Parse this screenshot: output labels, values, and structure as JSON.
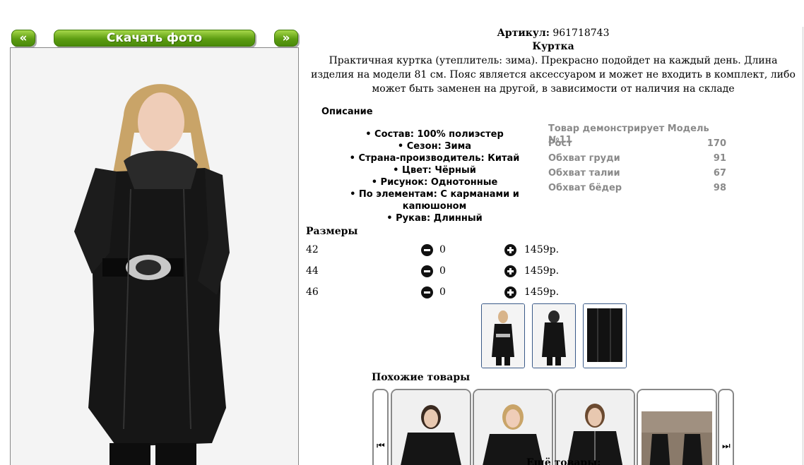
{
  "gallery": {
    "prev_label": "«",
    "next_label": "»",
    "download_label": "Скачать фото"
  },
  "product": {
    "article_label": "Артикул:",
    "article_value": "961718743",
    "title": "Куртка",
    "description": "Практичная куртка (утеплитель: зима). Прекрасно подойдет на каждый день. Длина изделия на модели 81 см. Пояс является аксессуаром и может не входить в комплект, либо может быть заменен на другой, в зависимости от наличия на складе"
  },
  "specs": {
    "title": "Описание",
    "items": [
      "• Состав: 100% полиэстер",
      "• Сезон: Зима",
      "• Страна-производитель: Китай",
      "• Цвет: Чёрный",
      "• Рисунок: Однотонные",
      "• По элементам: С карманами и капюшоном",
      "• Рукав: Длинный"
    ]
  },
  "model": {
    "heading": "Товар демонстрирует Модель №11",
    "rows": [
      {
        "label": "Рост",
        "value": "170"
      },
      {
        "label": "Обхват груди",
        "value": "91"
      },
      {
        "label": "Обхват талии",
        "value": "67"
      },
      {
        "label": "Обхват бёдер",
        "value": "98"
      }
    ]
  },
  "sizes": {
    "title": "Размеры",
    "rows": [
      {
        "size": "42",
        "qty": "0",
        "price": "1459р."
      },
      {
        "size": "44",
        "qty": "0",
        "price": "1459р."
      },
      {
        "size": "46",
        "qty": "0",
        "price": "1459р."
      }
    ]
  },
  "similar": {
    "title": "Похожие товары"
  },
  "more": {
    "title": "Ещё товары:"
  },
  "icons": {
    "minus": "minus-circle-icon",
    "plus": "plus-circle-icon",
    "carousel_prev": "skip-back-icon",
    "carousel_next": "skip-forward-icon"
  },
  "colors": {
    "button_green": "#5d9d12",
    "thumb_border": "#3a5a88",
    "model_text": "#8a8a8a"
  }
}
